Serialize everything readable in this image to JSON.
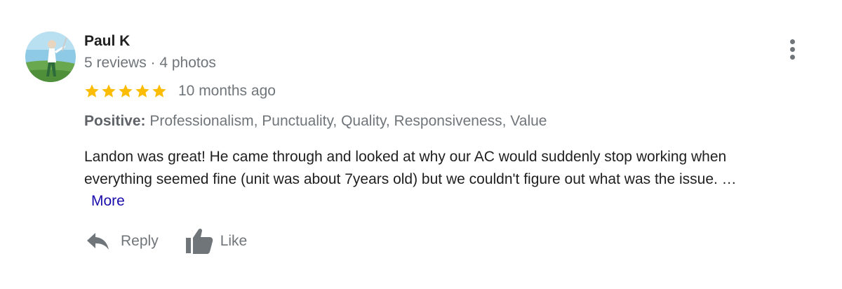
{
  "reviewer": {
    "name": "Paul K",
    "stats": "5 reviews · 4 photos",
    "avatar": "avatar-photo"
  },
  "menu": {
    "icon": "more-vertical-icon"
  },
  "rating": {
    "stars": 5,
    "max_stars": 5,
    "star_color": "#fbbc04",
    "time_ago": "10 months ago"
  },
  "highlights": {
    "label": "Positive:",
    "items": " Professionalism, Punctuality, Quality, Responsiveness, Value"
  },
  "review": {
    "lines": [
      "Landon was great! He came through and looked at why our AC would suddenly stop working  when",
      "everything seemed fine (unit was about 7years old) but we couldn't figure out what was the issue. …"
    ],
    "more_label": "More",
    "more_color": "#1a0dab"
  },
  "actions": {
    "reply_label": "Reply",
    "reply_icon": "reply-icon",
    "like_label": "Like",
    "like_icon": "thumbs-up-icon"
  }
}
